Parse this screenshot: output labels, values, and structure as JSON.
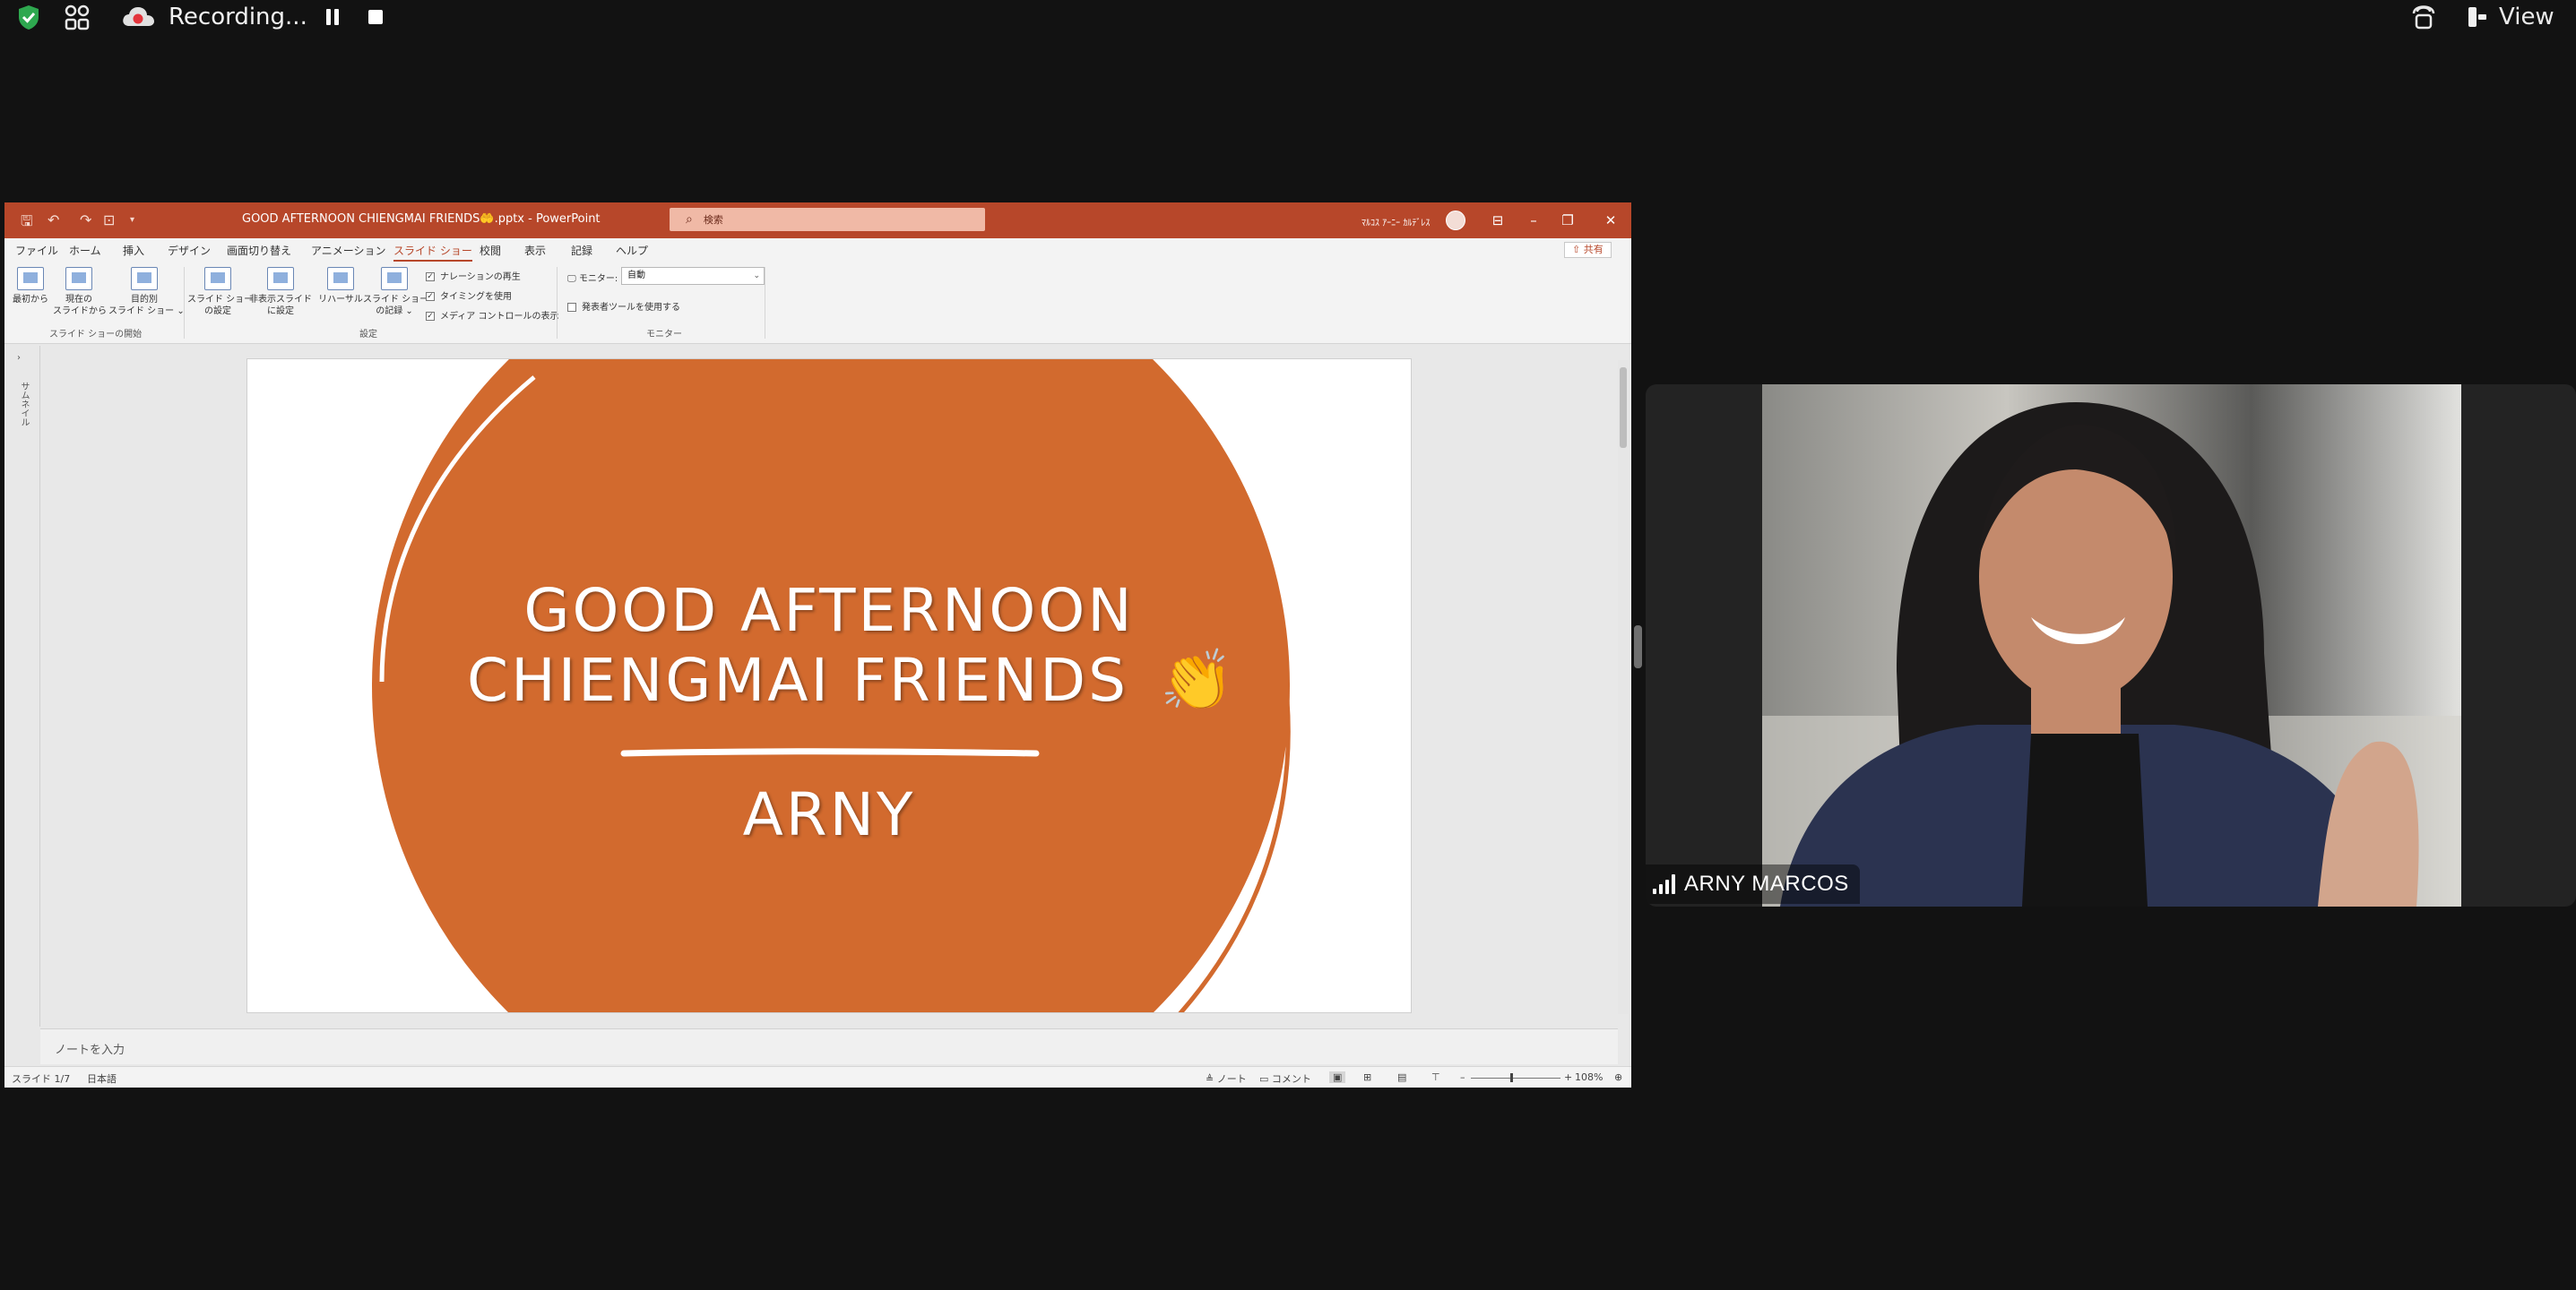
{
  "zoom": {
    "recording_label": "Recording...",
    "view_label": "View"
  },
  "ppt": {
    "doc_title": "GOOD AFTERNOON CHIENGMAI FRIENDS🤲.pptx - PowerPoint",
    "search_placeholder": "検索",
    "user_name": "ﾏﾙｺｽ ｱｰﾆｰ ｶﾙﾃﾞﾚｽ",
    "tabs": [
      "ファイル",
      "ホーム",
      "挿入",
      "デザイン",
      "画面切り替え",
      "アニメーション",
      "スライド ショー",
      "校閲",
      "表示",
      "記録",
      "ヘルプ"
    ],
    "active_tab": "スライド ショー",
    "share_label": "共有",
    "ribbon": {
      "from_start": "最初から",
      "from_current": "現在の\nスライドから",
      "custom_show": "目的別\nスライド ショー ⌄",
      "setup_show": "スライド ショー\nの設定",
      "hide_slide": "非表示スライド\nに設定",
      "rehearse": "リハーサル",
      "record": "スライド ショー\nの記録 ⌄",
      "check_narration": "ナレーションの再生",
      "check_timing": "タイミングを使用",
      "check_media": "メディア コントロールの表示",
      "monitor_label": "モニター:",
      "monitor_value": "自動",
      "presenter_view": "発表者ツールを使用する",
      "group_start": "スライド ショーの開始",
      "group_setup": "設定",
      "group_monitor": "モニター"
    },
    "thumb_label": "サムネイル",
    "slide": {
      "line1": "GOOD AFTERNOON",
      "line2": "CHIENGMAI FRIENDS",
      "emoji": "👏",
      "name": "ARNY",
      "circle_color": "#d26a2e"
    },
    "notes_placeholder": "ノートを入力",
    "status": {
      "slide_counter": "スライド 1/7",
      "language": "日本語",
      "notes_btn": "ノート",
      "comments_btn": "コメント",
      "zoom_level": "108%"
    }
  },
  "participant": {
    "name": "ARNY MARCOS"
  }
}
